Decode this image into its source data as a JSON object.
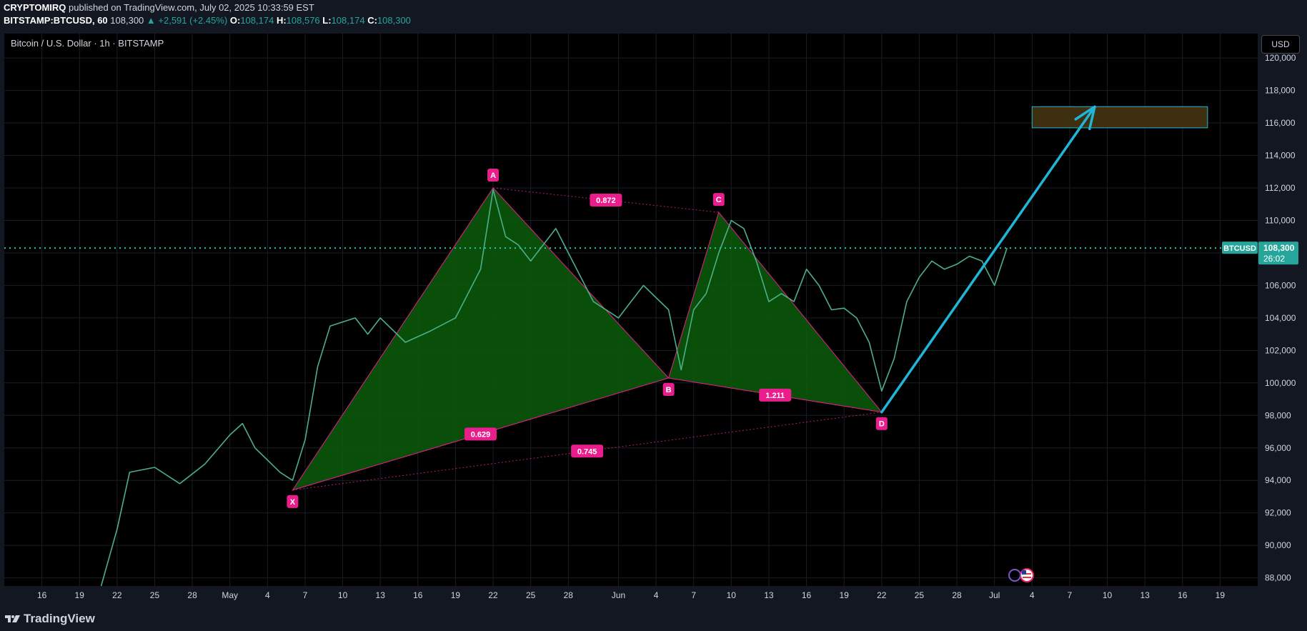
{
  "header": {
    "publisher": "CRYPTOMIRQ",
    "published_text": "published on TradingView.com, July 02, 2025 10:33:59 EST",
    "symbol": "BITSTAMP:BTCUSD, 60",
    "price": "108,300",
    "change": "▲ +2,591 (+2.45%)",
    "o_label": "O:",
    "o_value": "108,174",
    "h_label": "H:",
    "h_value": "108,576",
    "l_label": "L:",
    "l_value": "108,174",
    "c_label": "C:",
    "c_value": "108,300"
  },
  "chart_title": "Bitcoin / U.S. Dollar · 1h · BITSTAMP",
  "currency_button": "USD",
  "price_tag": {
    "symbol": "BTCUSD",
    "price": "108,300",
    "countdown": "26:02"
  },
  "brand": "TradingView",
  "colors": {
    "background": "#000000",
    "panel": "#131722",
    "accent": "#26a69a",
    "price_line": "#26c6b0",
    "pattern_fill": "#0a5c0a",
    "pattern_label": "#e91e8c",
    "arrow": "#1fb6d8",
    "target_box": "#3d2f10"
  },
  "icons": [
    "tradingview-logo-icon",
    "us-flag-icon",
    "spark-icon"
  ],
  "chart_data": {
    "type": "line",
    "title": "Bitcoin / U.S. Dollar · 1h · BITSTAMP",
    "ylim": [
      87500,
      121500
    ],
    "y_ticks": [
      88000,
      90000,
      92000,
      94000,
      96000,
      98000,
      100000,
      102000,
      104000,
      106000,
      108000,
      110000,
      112000,
      114000,
      116000,
      118000,
      120000
    ],
    "y_tick_labels": [
      "88,000",
      "90,000",
      "92,000",
      "94,000",
      "96,000",
      "98,000",
      "100,000",
      "102,000",
      "104,000",
      "106,000",
      "108,000",
      "110,000",
      "112,000",
      "114,000",
      "116,000",
      "118,000",
      "120,000"
    ],
    "x_start": "2025-04-13",
    "x_end": "2025-07-22",
    "x_ticks": [
      "2025-04-16",
      "2025-04-19",
      "2025-04-22",
      "2025-04-25",
      "2025-04-28",
      "2025-05-01",
      "2025-05-04",
      "2025-05-07",
      "2025-05-10",
      "2025-05-13",
      "2025-05-16",
      "2025-05-19",
      "2025-05-22",
      "2025-05-25",
      "2025-05-28",
      "2025-06-01",
      "2025-06-04",
      "2025-06-07",
      "2025-06-10",
      "2025-06-13",
      "2025-06-16",
      "2025-06-19",
      "2025-06-22",
      "2025-06-25",
      "2025-06-28",
      "2025-07-01",
      "2025-07-04",
      "2025-07-07",
      "2025-07-10",
      "2025-07-13",
      "2025-07-16",
      "2025-07-19"
    ],
    "x_tick_labels": [
      "16",
      "19",
      "22",
      "25",
      "28",
      "May",
      "4",
      "7",
      "10",
      "13",
      "16",
      "19",
      "22",
      "25",
      "28",
      "Jun",
      "4",
      "7",
      "10",
      "13",
      "16",
      "19",
      "22",
      "25",
      "28",
      "Jul",
      "4",
      "7",
      "10",
      "13",
      "16",
      "19"
    ],
    "grid": true,
    "current_price": 108300,
    "price_series": [
      {
        "x": "2025-04-20",
        "y": 85500
      },
      {
        "x": "2025-04-22",
        "y": 91000
      },
      {
        "x": "2025-04-23",
        "y": 94500
      },
      {
        "x": "2025-04-25",
        "y": 94800
      },
      {
        "x": "2025-04-27",
        "y": 93800
      },
      {
        "x": "2025-04-29",
        "y": 95000
      },
      {
        "x": "2025-05-01",
        "y": 96800
      },
      {
        "x": "2025-05-02",
        "y": 97500
      },
      {
        "x": "2025-05-03",
        "y": 96000
      },
      {
        "x": "2025-05-05",
        "y": 94500
      },
      {
        "x": "2025-05-06",
        "y": 94000
      },
      {
        "x": "2025-05-07",
        "y": 96500
      },
      {
        "x": "2025-05-08",
        "y": 101000
      },
      {
        "x": "2025-05-09",
        "y": 103500
      },
      {
        "x": "2025-05-11",
        "y": 104000
      },
      {
        "x": "2025-05-12",
        "y": 103000
      },
      {
        "x": "2025-05-13",
        "y": 104000
      },
      {
        "x": "2025-05-15",
        "y": 102500
      },
      {
        "x": "2025-05-17",
        "y": 103200
      },
      {
        "x": "2025-05-19",
        "y": 104000
      },
      {
        "x": "2025-05-21",
        "y": 107000
      },
      {
        "x": "2025-05-22",
        "y": 111900
      },
      {
        "x": "2025-05-23",
        "y": 109000
      },
      {
        "x": "2025-05-24",
        "y": 108500
      },
      {
        "x": "2025-05-25",
        "y": 107500
      },
      {
        "x": "2025-05-27",
        "y": 109500
      },
      {
        "x": "2025-05-28",
        "y": 108000
      },
      {
        "x": "2025-05-30",
        "y": 105000
      },
      {
        "x": "2025-06-01",
        "y": 104000
      },
      {
        "x": "2025-06-02",
        "y": 105000
      },
      {
        "x": "2025-06-03",
        "y": 106000
      },
      {
        "x": "2025-06-05",
        "y": 104500
      },
      {
        "x": "2025-06-06",
        "y": 100800
      },
      {
        "x": "2025-06-07",
        "y": 104500
      },
      {
        "x": "2025-06-08",
        "y": 105500
      },
      {
        "x": "2025-06-09",
        "y": 108000
      },
      {
        "x": "2025-06-10",
        "y": 110000
      },
      {
        "x": "2025-06-11",
        "y": 109500
      },
      {
        "x": "2025-06-12",
        "y": 107500
      },
      {
        "x": "2025-06-13",
        "y": 105000
      },
      {
        "x": "2025-06-14",
        "y": 105500
      },
      {
        "x": "2025-06-15",
        "y": 105000
      },
      {
        "x": "2025-06-16",
        "y": 107000
      },
      {
        "x": "2025-06-17",
        "y": 106000
      },
      {
        "x": "2025-06-18",
        "y": 104500
      },
      {
        "x": "2025-06-19",
        "y": 104600
      },
      {
        "x": "2025-06-20",
        "y": 104000
      },
      {
        "x": "2025-06-21",
        "y": 102500
      },
      {
        "x": "2025-06-22",
        "y": 99500
      },
      {
        "x": "2025-06-23",
        "y": 101500
      },
      {
        "x": "2025-06-24",
        "y": 105000
      },
      {
        "x": "2025-06-25",
        "y": 106500
      },
      {
        "x": "2025-06-26",
        "y": 107500
      },
      {
        "x": "2025-06-27",
        "y": 107000
      },
      {
        "x": "2025-06-28",
        "y": 107300
      },
      {
        "x": "2025-06-29",
        "y": 107800
      },
      {
        "x": "2025-06-30",
        "y": 107500
      },
      {
        "x": "2025-07-01",
        "y": 106000
      },
      {
        "x": "2025-07-02",
        "y": 108300
      }
    ],
    "harmonic_pattern": {
      "points": [
        {
          "label": "X",
          "x": "2025-05-06",
          "y": 93400
        },
        {
          "label": "A",
          "x": "2025-05-22",
          "y": 112000
        },
        {
          "label": "B",
          "x": "2025-06-05",
          "y": 100300
        },
        {
          "label": "C",
          "x": "2025-06-09",
          "y": 110500
        },
        {
          "label": "D",
          "x": "2025-06-22",
          "y": 98200
        }
      ],
      "ratios": [
        {
          "label": "0.629",
          "from": "X",
          "to": "B"
        },
        {
          "label": "0.872",
          "from": "A",
          "to": "C"
        },
        {
          "label": "1.211",
          "from": "B",
          "to": "D"
        },
        {
          "label": "0.745",
          "from": "X",
          "to": "D"
        }
      ]
    },
    "projection": {
      "arrow_from": {
        "x": "2025-06-22",
        "y": 98200
      },
      "arrow_to": {
        "x": "2025-07-09",
        "y": 117000
      },
      "target_zone": {
        "x_from": "2025-07-04",
        "x_to": "2025-07-18",
        "y_from": 115700,
        "y_to": 117000
      }
    }
  }
}
